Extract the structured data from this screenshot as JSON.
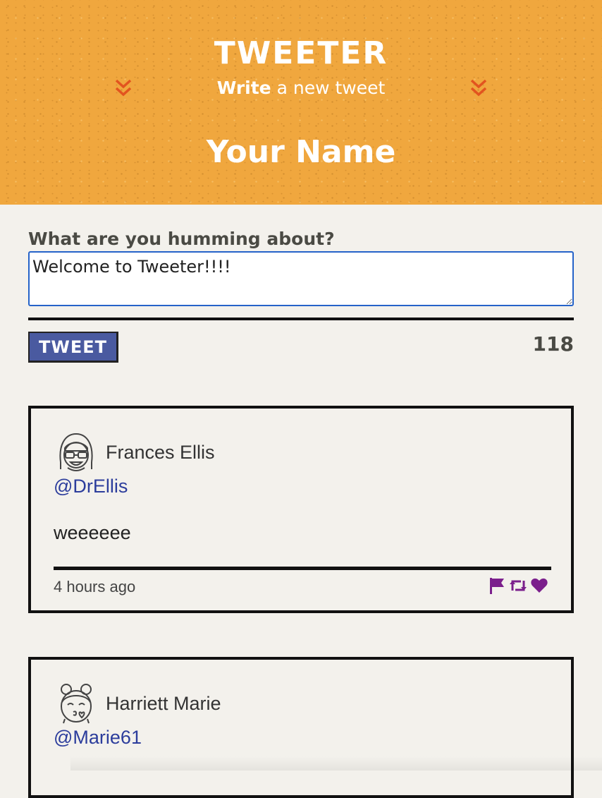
{
  "header": {
    "logo": "TWEETER",
    "subtitle_strong": "Write",
    "subtitle_rest": "a new tweet",
    "username": "Your Name",
    "chevron_icon": "double-chevron-down-icon",
    "chevron_color": "#e2541f",
    "background_color": "#f0a73e"
  },
  "compose": {
    "label": "What are you humming about?",
    "value": "Welcome to Tweeter!!!!",
    "button_label": "TWEET",
    "button_color": "#4a5aa0",
    "counter": "118"
  },
  "tweets": [
    {
      "author": "Frances Ellis",
      "handle": "@DrEllis",
      "content": "weeeeee",
      "time": "4 hours ago",
      "avatar_icon": "glasses-girl-avatar-icon",
      "actions": [
        "flag-icon",
        "retweet-icon",
        "heart-icon"
      ],
      "action_color": "#7b1f8c"
    },
    {
      "author": "Harriett Marie",
      "handle": "@Marie61",
      "avatar_icon": "kiss-girl-avatar-icon"
    }
  ]
}
